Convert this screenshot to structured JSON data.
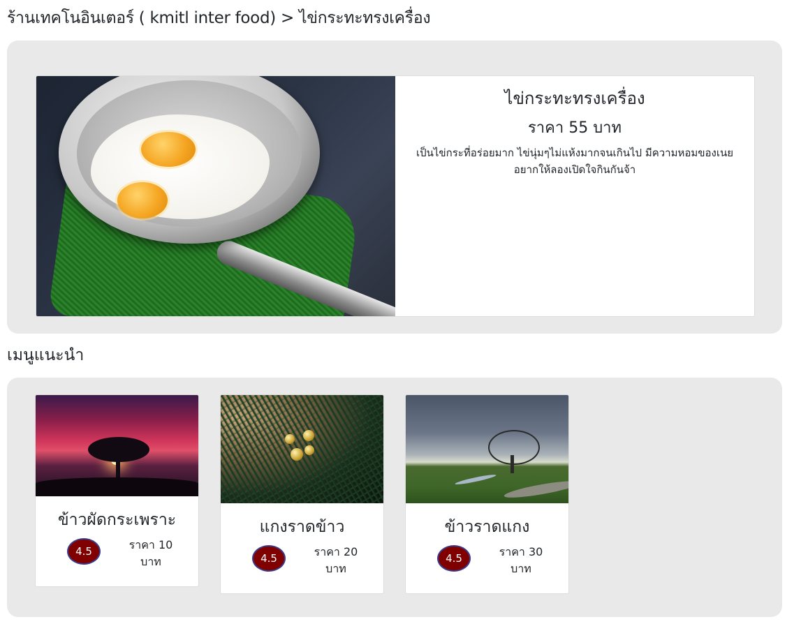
{
  "breadcrumb": {
    "shop": "ร้านเทคโนอินเตอร์ ( kmitl inter food)",
    "separator": " > ",
    "current": "ไข่กระทะทรงเครื่อง"
  },
  "detail": {
    "name": "ไข่กระทะทรงเครื่อง",
    "price_text": "ราคา 55 บาท",
    "description": "เป็นไข่กระที่อร่อยมาก ไข่นุ่มๆไม่แห้งมากจนเกินไป มีความหอมของเนย อยากให้ลองเปิดใจกินกันจ้า"
  },
  "recommend": {
    "title": "เมนูแนะนำ",
    "items": [
      {
        "name": "ข้าวผัดกระเพราะ",
        "rating": "4.5",
        "price_line1": "ราคา 10",
        "price_line2": "บาท"
      },
      {
        "name": "แกงราดข้าว",
        "rating": "4.5",
        "price_line1": "ราคา 20",
        "price_line2": "บาท"
      },
      {
        "name": "ข้าวราดแกง",
        "rating": "4.5",
        "price_line1": "ราคา 30",
        "price_line2": "บาท"
      }
    ]
  },
  "colors": {
    "panel_bg": "#e9e9e9",
    "rating_badge": "#800000",
    "rating_border": "#3b3b8a"
  }
}
